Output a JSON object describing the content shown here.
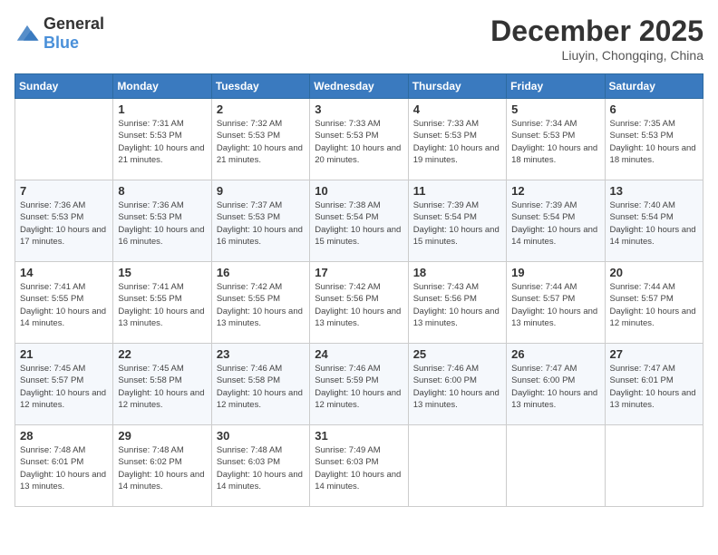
{
  "logo": {
    "general": "General",
    "blue": "Blue"
  },
  "title": {
    "month_year": "December 2025",
    "location": "Liuyin, Chongqing, China"
  },
  "days_of_week": [
    "Sunday",
    "Monday",
    "Tuesday",
    "Wednesday",
    "Thursday",
    "Friday",
    "Saturday"
  ],
  "weeks": [
    [
      {
        "day": "",
        "info": ""
      },
      {
        "day": "1",
        "info": "Sunrise: 7:31 AM\nSunset: 5:53 PM\nDaylight: 10 hours and 21 minutes."
      },
      {
        "day": "2",
        "info": "Sunrise: 7:32 AM\nSunset: 5:53 PM\nDaylight: 10 hours and 21 minutes."
      },
      {
        "day": "3",
        "info": "Sunrise: 7:33 AM\nSunset: 5:53 PM\nDaylight: 10 hours and 20 minutes."
      },
      {
        "day": "4",
        "info": "Sunrise: 7:33 AM\nSunset: 5:53 PM\nDaylight: 10 hours and 19 minutes."
      },
      {
        "day": "5",
        "info": "Sunrise: 7:34 AM\nSunset: 5:53 PM\nDaylight: 10 hours and 18 minutes."
      },
      {
        "day": "6",
        "info": "Sunrise: 7:35 AM\nSunset: 5:53 PM\nDaylight: 10 hours and 18 minutes."
      }
    ],
    [
      {
        "day": "7",
        "info": "Sunrise: 7:36 AM\nSunset: 5:53 PM\nDaylight: 10 hours and 17 minutes."
      },
      {
        "day": "8",
        "info": "Sunrise: 7:36 AM\nSunset: 5:53 PM\nDaylight: 10 hours and 16 minutes."
      },
      {
        "day": "9",
        "info": "Sunrise: 7:37 AM\nSunset: 5:53 PM\nDaylight: 10 hours and 16 minutes."
      },
      {
        "day": "10",
        "info": "Sunrise: 7:38 AM\nSunset: 5:54 PM\nDaylight: 10 hours and 15 minutes."
      },
      {
        "day": "11",
        "info": "Sunrise: 7:39 AM\nSunset: 5:54 PM\nDaylight: 10 hours and 15 minutes."
      },
      {
        "day": "12",
        "info": "Sunrise: 7:39 AM\nSunset: 5:54 PM\nDaylight: 10 hours and 14 minutes."
      },
      {
        "day": "13",
        "info": "Sunrise: 7:40 AM\nSunset: 5:54 PM\nDaylight: 10 hours and 14 minutes."
      }
    ],
    [
      {
        "day": "14",
        "info": "Sunrise: 7:41 AM\nSunset: 5:55 PM\nDaylight: 10 hours and 14 minutes."
      },
      {
        "day": "15",
        "info": "Sunrise: 7:41 AM\nSunset: 5:55 PM\nDaylight: 10 hours and 13 minutes."
      },
      {
        "day": "16",
        "info": "Sunrise: 7:42 AM\nSunset: 5:55 PM\nDaylight: 10 hours and 13 minutes."
      },
      {
        "day": "17",
        "info": "Sunrise: 7:42 AM\nSunset: 5:56 PM\nDaylight: 10 hours and 13 minutes."
      },
      {
        "day": "18",
        "info": "Sunrise: 7:43 AM\nSunset: 5:56 PM\nDaylight: 10 hours and 13 minutes."
      },
      {
        "day": "19",
        "info": "Sunrise: 7:44 AM\nSunset: 5:57 PM\nDaylight: 10 hours and 13 minutes."
      },
      {
        "day": "20",
        "info": "Sunrise: 7:44 AM\nSunset: 5:57 PM\nDaylight: 10 hours and 12 minutes."
      }
    ],
    [
      {
        "day": "21",
        "info": "Sunrise: 7:45 AM\nSunset: 5:57 PM\nDaylight: 10 hours and 12 minutes."
      },
      {
        "day": "22",
        "info": "Sunrise: 7:45 AM\nSunset: 5:58 PM\nDaylight: 10 hours and 12 minutes."
      },
      {
        "day": "23",
        "info": "Sunrise: 7:46 AM\nSunset: 5:58 PM\nDaylight: 10 hours and 12 minutes."
      },
      {
        "day": "24",
        "info": "Sunrise: 7:46 AM\nSunset: 5:59 PM\nDaylight: 10 hours and 12 minutes."
      },
      {
        "day": "25",
        "info": "Sunrise: 7:46 AM\nSunset: 6:00 PM\nDaylight: 10 hours and 13 minutes."
      },
      {
        "day": "26",
        "info": "Sunrise: 7:47 AM\nSunset: 6:00 PM\nDaylight: 10 hours and 13 minutes."
      },
      {
        "day": "27",
        "info": "Sunrise: 7:47 AM\nSunset: 6:01 PM\nDaylight: 10 hours and 13 minutes."
      }
    ],
    [
      {
        "day": "28",
        "info": "Sunrise: 7:48 AM\nSunset: 6:01 PM\nDaylight: 10 hours and 13 minutes."
      },
      {
        "day": "29",
        "info": "Sunrise: 7:48 AM\nSunset: 6:02 PM\nDaylight: 10 hours and 14 minutes."
      },
      {
        "day": "30",
        "info": "Sunrise: 7:48 AM\nSunset: 6:03 PM\nDaylight: 10 hours and 14 minutes."
      },
      {
        "day": "31",
        "info": "Sunrise: 7:49 AM\nSunset: 6:03 PM\nDaylight: 10 hours and 14 minutes."
      },
      {
        "day": "",
        "info": ""
      },
      {
        "day": "",
        "info": ""
      },
      {
        "day": "",
        "info": ""
      }
    ]
  ]
}
